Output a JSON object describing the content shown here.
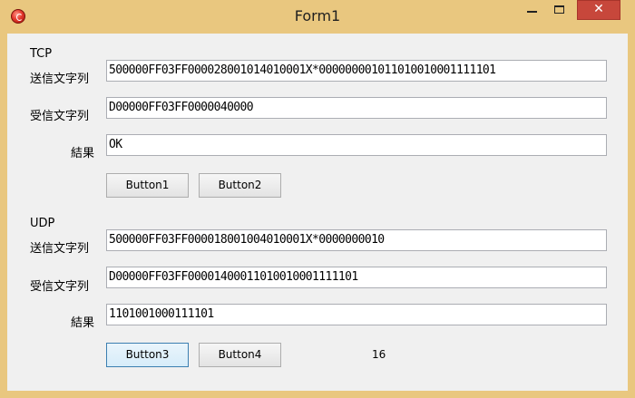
{
  "window": {
    "title": "Form1",
    "close_glyph": "✕"
  },
  "tcp": {
    "group_label": "TCP",
    "send_label": "送信文字列",
    "send_value": "500000FF03FF000028001014010001X*000000001011010010001111101",
    "recv_label": "受信文字列",
    "recv_value": "D00000FF03FF0000040000",
    "result_label": "結果",
    "result_value": "OK",
    "button1_label": "Button1",
    "button2_label": "Button2"
  },
  "udp": {
    "group_label": "UDP",
    "send_label": "送信文字列",
    "send_value": "500000FF03FF000018001004010001X*0000000010",
    "recv_label": "受信文字列",
    "recv_value": "D00000FF03FF00001400011010010001111101",
    "result_label": "結果",
    "result_value": "1101001000111101",
    "button3_label": "Button3",
    "button4_label": "Button4",
    "count_value": "16"
  }
}
